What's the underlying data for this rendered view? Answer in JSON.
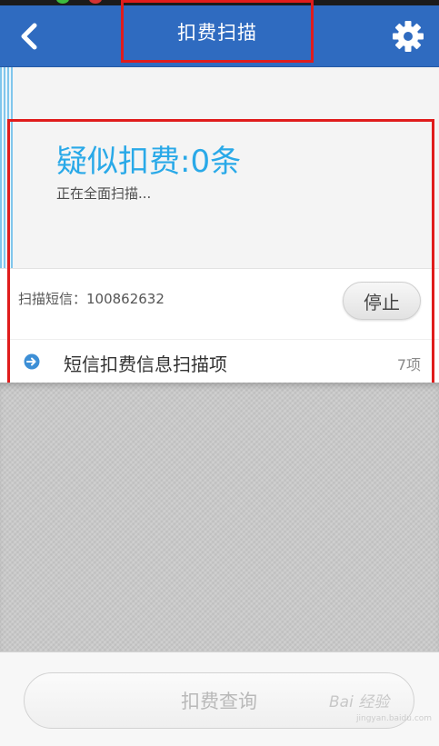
{
  "header": {
    "title": "扣费扫描",
    "back_icon": "back-arrow-icon",
    "settings_icon": "gear-icon"
  },
  "summary": {
    "suspected": "疑似扣费:0条",
    "status": "正在全面扫描..."
  },
  "scan": {
    "label": "扫描短信：100862632",
    "stop_label": "停止"
  },
  "scan_item": {
    "icon": "arrow-circle-icon",
    "label": "短信扣费信息扫描项",
    "count": "7项"
  },
  "footer": {
    "query_label": "扣费查询"
  },
  "watermark": {
    "text": "Bai 经验",
    "sub": "jingyan.baidu.com"
  },
  "colors": {
    "header_bg": "#2f6bc0",
    "accent": "#29a9e8",
    "highlight": "#e01c1c"
  }
}
